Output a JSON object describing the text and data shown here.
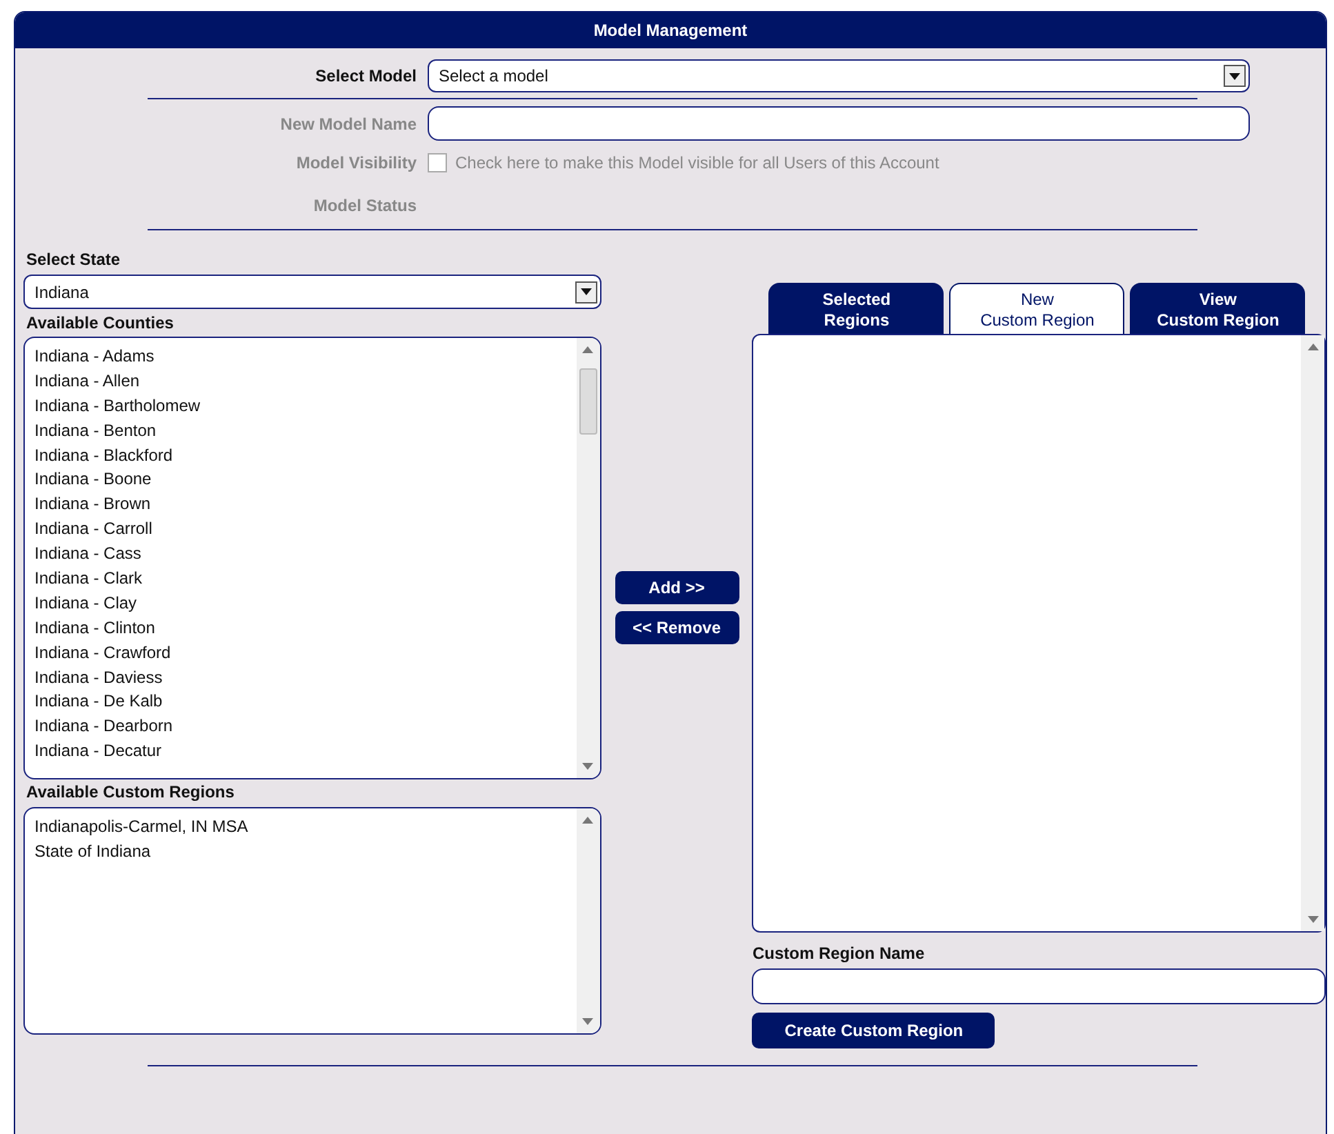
{
  "window": {
    "title": "Model Management"
  },
  "model_form": {
    "select_model": {
      "label": "Select Model",
      "value": "Select a model"
    },
    "new_model_name": {
      "label": "New Model Name",
      "disabled": true
    },
    "model_visibility": {
      "label": "Model Visibility",
      "text": "Check here to make this Model visible for all Users of this Account",
      "checked": false,
      "disabled": true
    },
    "model_status": {
      "label": "Model Status",
      "disabled": true
    }
  },
  "select_state": {
    "label": "Select State",
    "value": "Indiana"
  },
  "available_counties": {
    "label": "Available Counties",
    "items": [
      "Indiana - Adams",
      "Indiana - Allen",
      "Indiana - Bartholomew",
      "Indiana - Benton",
      "Indiana - Blackford",
      "Indiana - Boone",
      "Indiana - Brown",
      "Indiana - Carroll",
      "Indiana - Cass",
      "Indiana - Clark",
      "Indiana - Clay",
      "Indiana - Clinton",
      "Indiana - Crawford",
      "Indiana - Daviess",
      "Indiana - De Kalb",
      "Indiana - Dearborn",
      "Indiana - Decatur"
    ]
  },
  "available_custom_regions": {
    "label": "Available Custom Regions",
    "items": [
      "Indianapolis-Carmel, IN MSA",
      "State of Indiana"
    ]
  },
  "buttons": [
    "Add >>",
    "<< Remove"
  ],
  "tabs": [
    {
      "label": "Selected\nRegions",
      "selected": false
    },
    {
      "label": "New\nCustom Region",
      "selected": true
    },
    {
      "label": "View\nCustom Region",
      "selected": false
    }
  ],
  "custom_region_name": {
    "label": "Custom Region Name"
  },
  "create_button": "Create Custom Region"
}
